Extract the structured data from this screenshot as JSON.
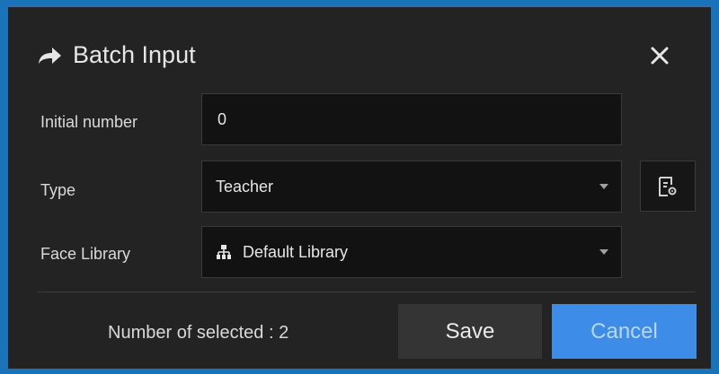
{
  "dialog": {
    "title": "Batch Input",
    "title_icon": "share-arrow-icon",
    "close_icon": "close-icon"
  },
  "form": {
    "initial_number_label": "Initial number",
    "initial_number_value": "0",
    "type_label": "Type",
    "type_value": "Teacher",
    "face_library_label": "Face Library",
    "face_library_value": "Default Library",
    "face_library_icon": "tree-structure-icon",
    "type_settings_icon": "document-settings-icon"
  },
  "footer": {
    "selected_text": "Number of selected : 2",
    "save_label": "Save",
    "cancel_label": "Cancel"
  },
  "colors": {
    "dialog_bg": "#232323",
    "field_bg": "#121212",
    "accent": "#3d8ce8",
    "save_bg": "#343434"
  }
}
